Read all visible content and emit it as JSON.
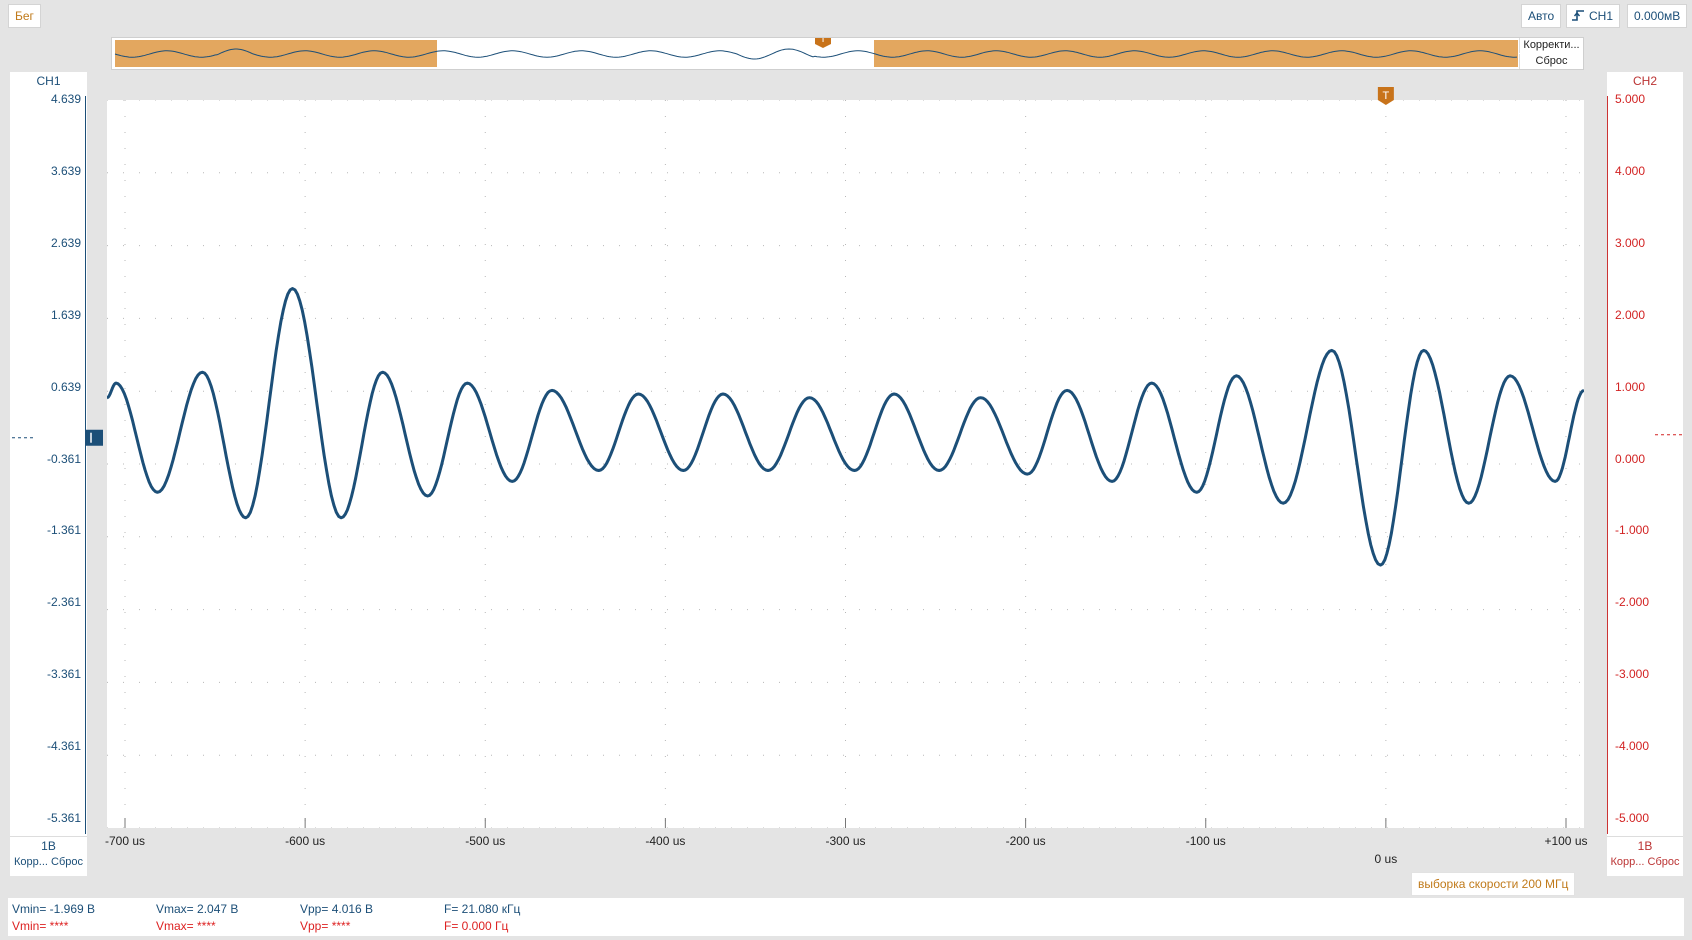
{
  "toolbar": {
    "run_label": "Бег",
    "mode_label": "Авто",
    "trigger_source_label": "CH1",
    "trigger_level_label": "0.000мВ"
  },
  "overview": {
    "correct_label": "Корректи...",
    "reset_label": "Сброс"
  },
  "ch1": {
    "title": "CH1",
    "scale": "1B",
    "foot": "Корр... Сброс",
    "ticks": [
      "4.639",
      "3.639",
      "2.639",
      "1.639",
      "0.639",
      "-0.361",
      "-1.361",
      "-2.361",
      "-3.361",
      "-4.361",
      "-5.361"
    ]
  },
  "ch2": {
    "title": "CH2",
    "scale": "1B",
    "foot": "Корр... Сброс",
    "ticks": [
      "5.000",
      "4.000",
      "3.000",
      "2.000",
      "1.000",
      "0.000",
      "-1.000",
      "-2.000",
      "-3.000",
      "-4.000",
      "-5.000"
    ]
  },
  "time_axis": {
    "ticks": [
      "-700 us",
      "-600 us",
      "-500 us",
      "-400 us",
      "-300 us",
      "-200 us",
      "-100 us",
      "0 us",
      "+100 us"
    ]
  },
  "sample_rate_label": "выборка скорости 200 МГц",
  "measurements": {
    "ch1": {
      "vmin": "Vmin= -1.969 B",
      "vmax": "Vmax= 2.047 B",
      "vpp": "Vpp= 4.016 B",
      "freq": "F= 21.080 кГц"
    },
    "ch2": {
      "vmin": "Vmin= ****",
      "vmax": "Vmax= ****",
      "vpp": "Vpp= ****",
      "freq": "F= 0.000 Гц"
    }
  },
  "colors": {
    "ch1": "#1c4f78",
    "ch2": "#d22222",
    "trigger": "#c8731a",
    "overview_highlight": "#e3a75f"
  },
  "chart_data": {
    "type": "line",
    "title": "",
    "xlabel": "",
    "ylabel": "",
    "xlim": [
      -710,
      110
    ],
    "ylim": [
      -5.361,
      4.639
    ],
    "x_unit": "us",
    "y_unit": "V",
    "grid": true,
    "series": [
      {
        "name": "CH1",
        "x": [
          -710,
          -705,
          -682,
          -657,
          -633,
          -607,
          -580,
          -557,
          -532,
          -510,
          -485,
          -463,
          -437,
          -415,
          -390,
          -368,
          -343,
          -320,
          -295,
          -273,
          -248,
          -225,
          -199,
          -177,
          -152,
          -130,
          -105,
          -83,
          -57,
          -30,
          -3,
          21,
          46,
          69,
          94,
          110
        ],
        "y": [
          0.55,
          0.75,
          -0.75,
          0.9,
          -1.1,
          2.05,
          -1.1,
          0.9,
          -0.8,
          0.75,
          -0.6,
          0.65,
          -0.45,
          0.6,
          -0.45,
          0.6,
          -0.45,
          0.55,
          -0.45,
          0.6,
          -0.45,
          0.55,
          -0.5,
          0.65,
          -0.6,
          0.75,
          -0.75,
          0.85,
          -0.9,
          1.2,
          -1.75,
          1.2,
          -0.9,
          0.85,
          -0.6,
          0.65
        ]
      }
    ]
  }
}
